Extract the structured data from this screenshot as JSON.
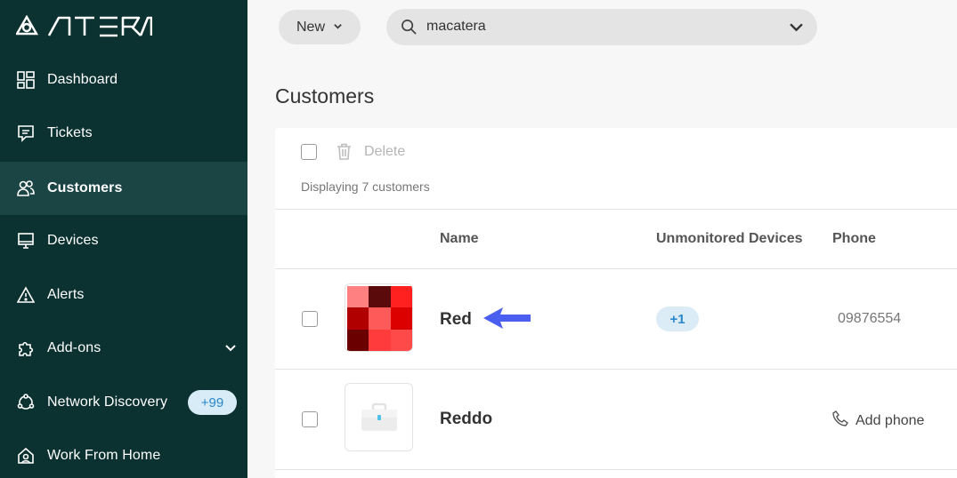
{
  "brand": {
    "name": "ATERA"
  },
  "sidebar": {
    "items": [
      {
        "label": "Dashboard",
        "icon": "dashboard-icon"
      },
      {
        "label": "Tickets",
        "icon": "tickets-icon"
      },
      {
        "label": "Customers",
        "icon": "customers-icon",
        "active": true
      },
      {
        "label": "Devices",
        "icon": "devices-icon"
      },
      {
        "label": "Alerts",
        "icon": "alert-icon"
      },
      {
        "label": "Add-ons",
        "icon": "puzzle-icon",
        "expandable": true
      },
      {
        "label": "Network Discovery",
        "icon": "network-icon",
        "badge": "+99"
      },
      {
        "label": "Work From Home",
        "icon": "home-icon"
      }
    ]
  },
  "topbar": {
    "new_label": "New",
    "search": {
      "value": "macatera",
      "icon": "search-icon"
    }
  },
  "page": {
    "title": "Customers"
  },
  "toolbar": {
    "delete_label": "Delete",
    "displaying": "Displaying 7 customers"
  },
  "table": {
    "columns": [
      "Name",
      "Unmonitored Devices",
      "Phone"
    ],
    "rows": [
      {
        "name": "Red",
        "unmonitored": "+1",
        "phone": "09876554",
        "avatar_colors": [
          "#ff8080",
          "#5a0a0a",
          "#ff2020",
          "#b00000",
          "#ff5a5a",
          "#dd0000",
          "#6a0000",
          "#ff3b3b",
          "#ff4a4a"
        ]
      },
      {
        "name": "Reddo",
        "unmonitored": "",
        "phone": "Add phone",
        "avatar": "briefcase-icon"
      }
    ]
  },
  "colors": {
    "sidebar_bg": "#0b3131",
    "sidebar_active": "#1b4545",
    "accent_blue": "#2a87c9",
    "arrow": "#4a5ef0"
  }
}
